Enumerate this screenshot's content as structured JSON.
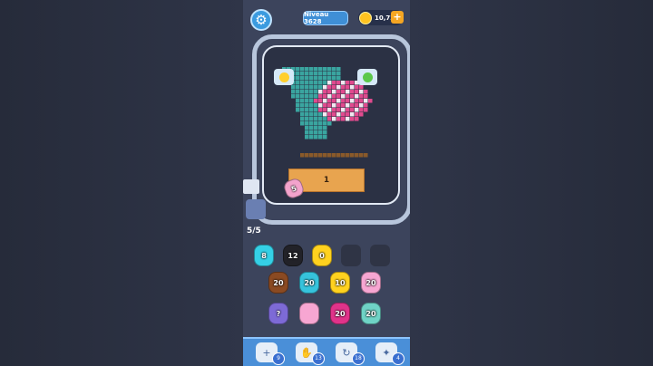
{
  "header": {
    "level_label": "Niveau 3628",
    "coins": "10,72k",
    "plus": "+"
  },
  "board": {
    "icons": [
      "bolt-icon",
      "cabbage-icon"
    ],
    "block_label": "1",
    "conveyor_pig_value": "5"
  },
  "queue": {
    "count": "5/5"
  },
  "holding_slots": [
    {
      "value": "8",
      "color": "#35d0e6",
      "filled": true
    },
    {
      "value": "12",
      "color": "#222228",
      "filled": true
    },
    {
      "value": "0",
      "color": "#ffd21f",
      "filled": true
    },
    {
      "value": "",
      "color": "",
      "filled": false
    },
    {
      "value": "",
      "color": "",
      "filled": false
    }
  ],
  "pig_rows": [
    [
      {
        "value": "20",
        "color": "#8a4a22"
      },
      {
        "value": "20",
        "color": "#36c3dc"
      },
      {
        "value": "10",
        "color": "#ffd21f"
      },
      {
        "value": "20",
        "color": "#f7a6d2"
      }
    ],
    [
      {
        "value": "?",
        "color": "#7d6ad6"
      },
      {
        "value": "",
        "color": "#f7a6d2"
      },
      {
        "value": "20",
        "color": "#e0338a"
      },
      {
        "value": "20",
        "color": "#6fd3c6"
      }
    ]
  ],
  "toolbar": [
    {
      "icon": "add-icon",
      "badge": "9"
    },
    {
      "icon": "hand-icon",
      "badge": "13"
    },
    {
      "icon": "shuffle-icon",
      "badge": "18"
    },
    {
      "icon": "magic-icon",
      "badge": "4"
    }
  ],
  "colors": {
    "teal": "#3aa5a0",
    "pink": "#e04a8e",
    "white": "#f2e8f0",
    "brown": "#8a5a2a",
    "crate": "#e8a44f"
  }
}
